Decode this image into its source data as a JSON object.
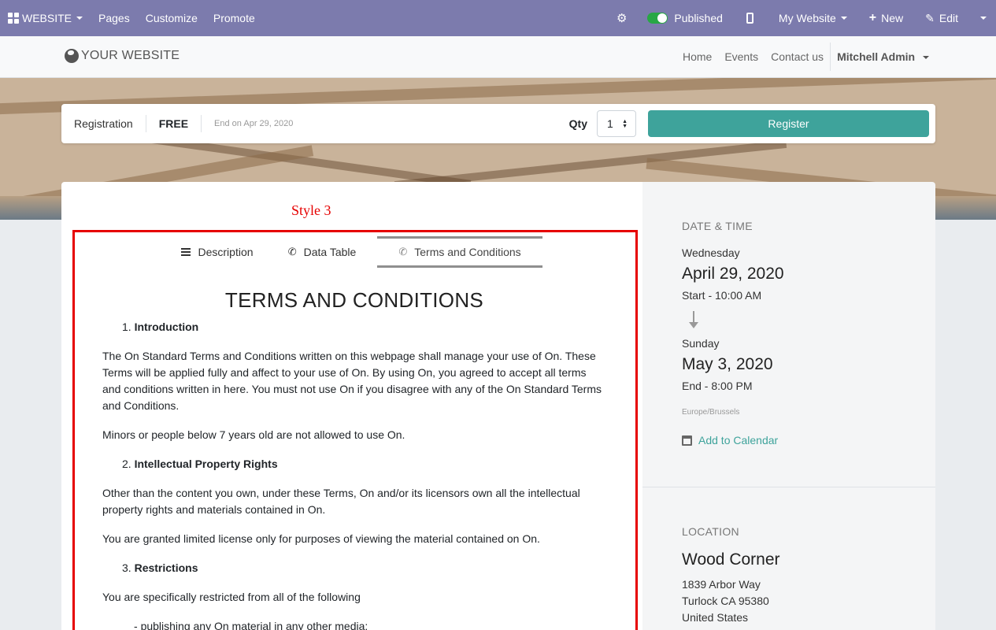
{
  "topbar": {
    "website": "WEBSITE",
    "pages": "Pages",
    "customize": "Customize",
    "promote": "Promote",
    "published": "Published",
    "my_website": "My Website",
    "new": "New",
    "edit": "Edit",
    "accent_color": "#7c7bad"
  },
  "header": {
    "logo": "YOUR WEBSITE",
    "nav": [
      "Home",
      "Events",
      "Contact us"
    ],
    "user": "Mitchell Admin"
  },
  "registration": {
    "label": "Registration",
    "price": "FREE",
    "end": "End on Apr 29, 2020",
    "qty_label": "Qty",
    "qty_value": "1",
    "button": "Register",
    "button_color": "#3ea39b"
  },
  "main": {
    "style_label": "Style 3",
    "tabs": [
      {
        "label": "Description",
        "icon": "bars-icon"
      },
      {
        "label": "Data Table",
        "icon": "phone-icon"
      },
      {
        "label": "Terms and Conditions",
        "icon": "phone-icon"
      }
    ],
    "title": "TERMS AND CONDITIONS",
    "sections": [
      {
        "num": "1.",
        "heading": "Introduction"
      },
      {
        "num": "2.",
        "heading": "Intellectual Property Rights"
      },
      {
        "num": "3.",
        "heading": "Restrictions"
      }
    ],
    "paragraphs": [
      "The On Standard Terms and Conditions written on this webpage shall manage your use of On. These Terms will be applied fully and affect to your use of On. By using On, you agreed to accept all terms and conditions written in here. You must not use On if you disagree with any of the On Standard Terms and Conditions.",
      "Minors or people below 7 years old are not allowed to use On.",
      "Other than the content you own, under these Terms, On and/or its licensors own all the intellectual property rights and materials contained in On.",
      "You are granted limited license only for purposes of viewing the material contained on On.",
      "You are specifically restricted from all of the following"
    ],
    "list": [
      "publishing any On material in any other media;"
    ]
  },
  "sidebar": {
    "date_label": "DATE & TIME",
    "start_day": "Wednesday",
    "start_date": "April 29, 2020",
    "start_time": "Start - 10:00 AM",
    "end_day": "Sunday",
    "end_date": "May 3, 2020",
    "end_time": "End - 8:00 PM",
    "timezone": "Europe/Brussels",
    "add_calendar": "Add to Calendar",
    "location_label": "LOCATION",
    "venue": "Wood Corner",
    "address1": "1839 Arbor Way",
    "address2": "Turlock CA 95380",
    "country": "United States"
  }
}
